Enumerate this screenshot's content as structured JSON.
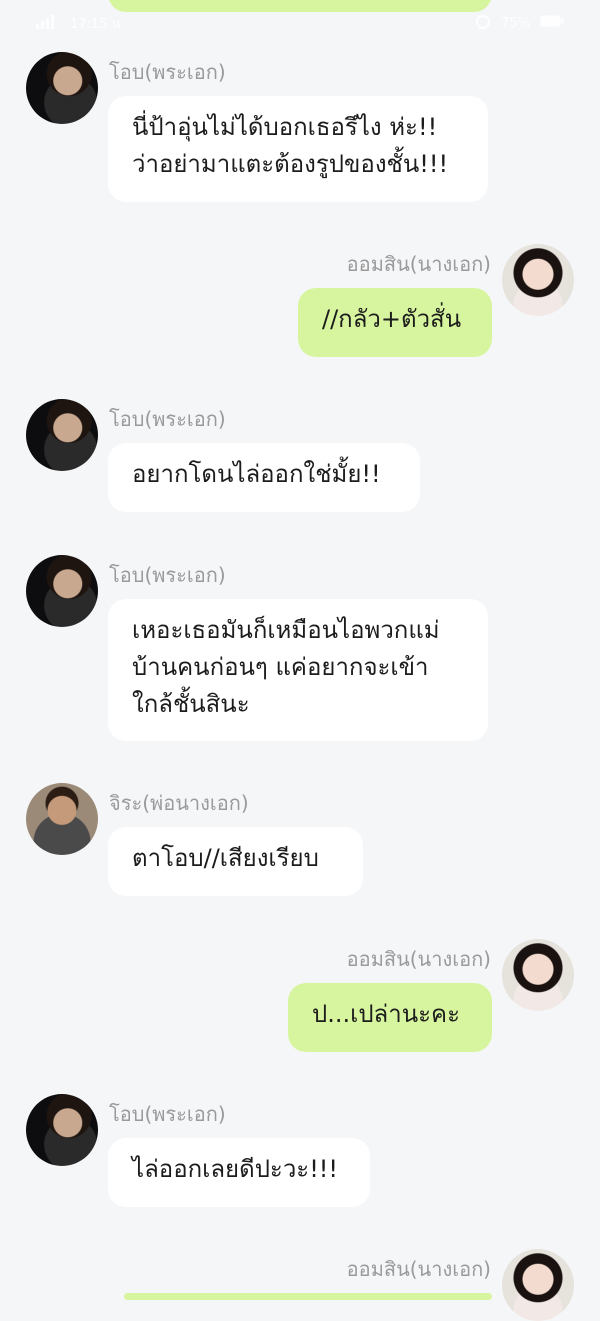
{
  "status_bar": {
    "time": "17:15 น.",
    "battery": "75%"
  },
  "messages": [
    {
      "side": "left",
      "sender": "โอบ(พระเอก)",
      "avatar": "avatar-male-lead",
      "text": "นี่ป้าอุ่นไม่ได้บอกเธอรึไง ห่ะ!!\nว่าอย่ามาแตะต้องรูปของชั้น!!!"
    },
    {
      "side": "right",
      "sender": "ออมสิน(นางเอก)",
      "avatar": "avatar-female-lead",
      "text": "//กลัว+ตัวสั่น"
    },
    {
      "side": "left",
      "sender": "โอบ(พระเอก)",
      "avatar": "avatar-male-lead",
      "text": "อยากโดนไล่ออกใช่มั้ย!!"
    },
    {
      "side": "left",
      "sender": "โอบ(พระเอก)",
      "avatar": "avatar-male-lead",
      "text": "เหอะเธอมันก็เหมือนไอพวกแม่\nบ้านคนก่อนๆ แค่อยากจะเข้า\nใกล้ชั้นสินะ"
    },
    {
      "side": "left",
      "sender": "จิระ(พ่อนางเอก)",
      "avatar": "avatar-father",
      "text": "ตาโอบ//เสียงเรียบ"
    },
    {
      "side": "right",
      "sender": "ออมสิน(นางเอก)",
      "avatar": "avatar-female-lead",
      "text": "ป...เปล่านะคะ"
    },
    {
      "side": "left",
      "sender": "โอบ(พระเอก)",
      "avatar": "avatar-male-lead",
      "text": "ไล่ออกเลยดีปะวะ!!!"
    },
    {
      "side": "right",
      "sender": "ออมสิน(นางเอก)",
      "avatar": "avatar-female-lead",
      "text": ""
    }
  ],
  "colors": {
    "background": "#f5f6f8",
    "bubble_left": "#ffffff",
    "bubble_right": "#d7f59e",
    "name_text": "#9a9a9a"
  }
}
